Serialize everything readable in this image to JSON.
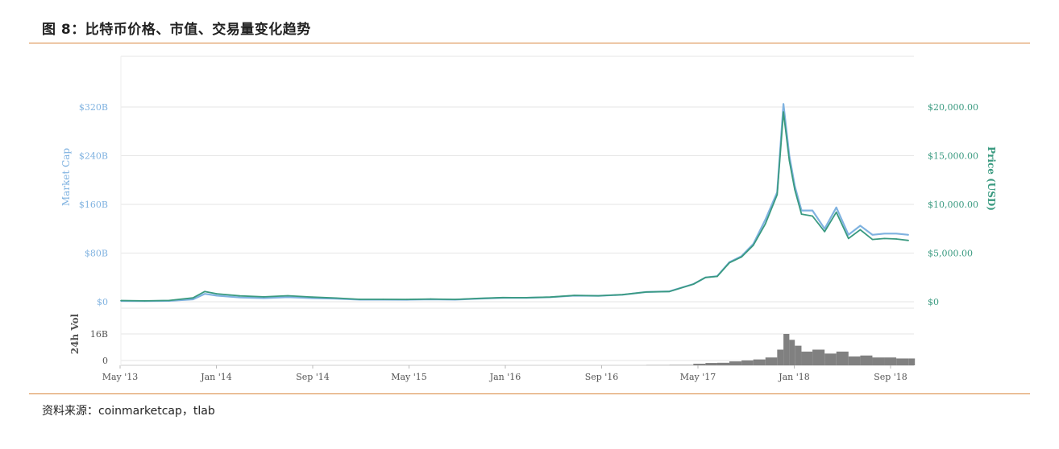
{
  "figure": {
    "title": "图 8：比特币价格、市值、交易量变化趋势",
    "source": "资料来源：coinmarketcap，tlab"
  },
  "colors": {
    "market_cap": "#7fb2e0",
    "price": "#3a9a80",
    "volume": "#808080",
    "grid": "#e6e6e6",
    "rule": "#d9873e"
  },
  "chart_data": {
    "type": "line",
    "xlabel": "",
    "x_ticks": [
      "May '13",
      "Jan '14",
      "Sep '14",
      "May '15",
      "Jan '16",
      "Sep '16",
      "May '17",
      "Jan '18",
      "Sep '18"
    ],
    "left_axis": {
      "label": "Market Cap",
      "ticks": [
        "$0",
        "$80B",
        "$160B",
        "$240B",
        "$320B"
      ],
      "range": [
        0,
        320
      ]
    },
    "right_axis": {
      "label": "Price (USD)",
      "ticks": [
        "$0",
        "$5,000.00",
        "$10,000.00",
        "$15,000.00",
        "$20,000.00"
      ],
      "range": [
        0,
        20000
      ]
    },
    "volume_axis": {
      "label": "24h Vol",
      "ticks": [
        "0",
        "16B"
      ],
      "range": [
        0,
        16
      ]
    },
    "x": [
      "2013-05",
      "2013-07",
      "2013-09",
      "2013-11",
      "2013-12",
      "2014-01",
      "2014-03",
      "2014-05",
      "2014-07",
      "2014-09",
      "2014-11",
      "2015-01",
      "2015-03",
      "2015-05",
      "2015-07",
      "2015-09",
      "2015-11",
      "2016-01",
      "2016-03",
      "2016-05",
      "2016-07",
      "2016-09",
      "2016-11",
      "2017-01",
      "2017-03",
      "2017-05",
      "2017-06",
      "2017-07",
      "2017-08",
      "2017-09",
      "2017-10",
      "2017-11",
      "2017-12-01",
      "2017-12-17",
      "2018-01",
      "2018-01-15",
      "2018-02",
      "2018-03",
      "2018-04",
      "2018-05",
      "2018-06",
      "2018-07",
      "2018-08",
      "2018-09",
      "2018-10",
      "2018-11"
    ],
    "series": [
      {
        "name": "Market Cap",
        "unit": "USD billions",
        "values": [
          1.3,
          1.1,
          1.4,
          4,
          13,
          10,
          7,
          6,
          7.5,
          6,
          5,
          3.5,
          3.5,
          3.3,
          4,
          3.5,
          5,
          6.5,
          6.5,
          7.5,
          10,
          9.8,
          11.5,
          16,
          17,
          29,
          40,
          42,
          65,
          75,
          95,
          135,
          180,
          325,
          240,
          190,
          150,
          150,
          120,
          155,
          110,
          125,
          110,
          112,
          112,
          110
        ]
      },
      {
        "name": "Price (USD)",
        "unit": "USD",
        "values": [
          120,
          90,
          130,
          400,
          1050,
          820,
          600,
          500,
          620,
          480,
          380,
          250,
          250,
          240,
          280,
          240,
          350,
          430,
          420,
          480,
          650,
          610,
          730,
          1000,
          1050,
          1800,
          2500,
          2600,
          4000,
          4600,
          5800,
          8000,
          11000,
          19500,
          14500,
          11500,
          9000,
          8800,
          7200,
          9200,
          6500,
          7400,
          6400,
          6500,
          6450,
          6300
        ]
      },
      {
        "name": "24h Vol",
        "unit": "USD billions",
        "values": [
          0,
          0,
          0,
          0,
          0,
          0,
          0,
          0,
          0,
          0,
          0,
          0,
          0,
          0,
          0,
          0,
          0,
          0,
          0,
          0,
          0,
          0,
          0,
          0.1,
          0.2,
          0.8,
          1.2,
          1.3,
          2,
          2.5,
          3,
          4,
          8,
          16,
          13,
          10,
          7,
          8,
          6,
          7,
          4.5,
          5,
          4,
          4,
          3.5,
          3.5
        ]
      }
    ]
  }
}
